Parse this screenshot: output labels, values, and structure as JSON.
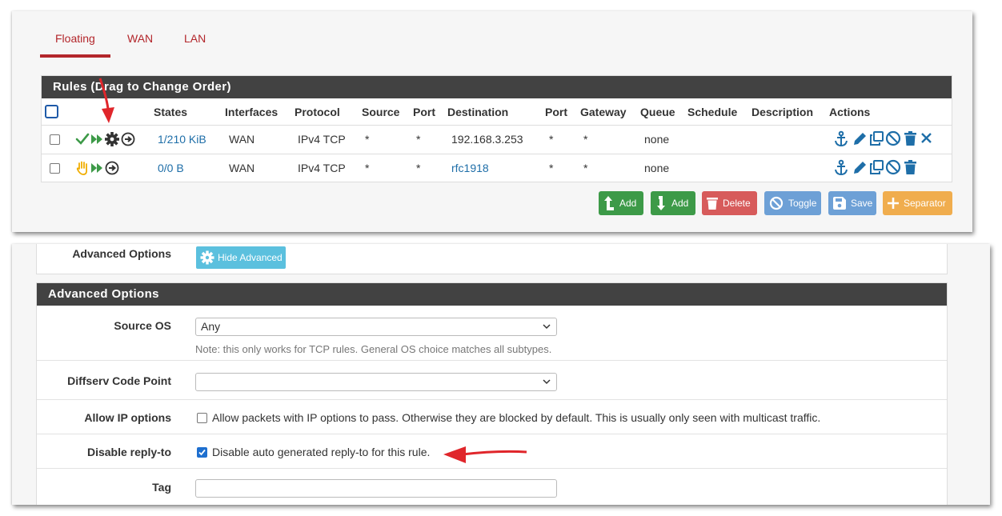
{
  "tabs": [
    {
      "label": "Floating",
      "active": true
    },
    {
      "label": "WAN",
      "active": false
    },
    {
      "label": "LAN",
      "active": false
    }
  ],
  "rules": {
    "title": "Rules (Drag to Change Order)",
    "columns": [
      "States",
      "Interfaces",
      "Protocol",
      "Source",
      "Port",
      "Destination",
      "Port",
      "Gateway",
      "Queue",
      "Schedule",
      "Description",
      "Actions"
    ],
    "rows": [
      {
        "states": "1/210 KiB",
        "interfaces": "WAN",
        "protocol": "IPv4 TCP",
        "source": "*",
        "source_port": "*",
        "destination": "192.168.3.253",
        "dest_port": "*",
        "gateway": "*",
        "queue": "none",
        "schedule": "",
        "description": "",
        "icons": [
          "check-icon",
          "forward-icon",
          "gear-icon",
          "arrow-circle-icon"
        ],
        "actions": [
          "anchor-icon",
          "pencil-icon",
          "copy-icon",
          "disable-icon",
          "trash-icon",
          "close-icon"
        ]
      },
      {
        "states": "0/0 B",
        "interfaces": "WAN",
        "protocol": "IPv4 TCP",
        "source": "*",
        "source_port": "*",
        "destination": "rfc1918",
        "dest_port": "*",
        "gateway": "*",
        "queue": "none",
        "schedule": "",
        "description": "",
        "icons": [
          "hand-icon",
          "forward-icon",
          "arrow-circle-icon"
        ],
        "actions": [
          "anchor-icon",
          "pencil-icon",
          "copy-icon",
          "disable-icon",
          "trash-icon"
        ]
      }
    ]
  },
  "buttons": {
    "add_top": "Add",
    "add_bottom": "Add",
    "delete": "Delete",
    "toggle": "Toggle",
    "save": "Save",
    "separator": "Separator"
  },
  "advanced_toggle": {
    "label": "Advanced Options",
    "button": "Hide Advanced"
  },
  "advanced": {
    "title": "Advanced Options",
    "source_os": {
      "label": "Source OS",
      "value": "Any",
      "note": "Note: this only works for TCP rules. General OS choice matches all subtypes."
    },
    "diffserv": {
      "label": "Diffserv Code Point",
      "value": ""
    },
    "allow_ip": {
      "label": "Allow IP options",
      "checked": false,
      "text": "Allow packets with IP options to pass. Otherwise they are blocked by default. This is usually only seen with multicast traffic."
    },
    "disable_reply": {
      "label": "Disable reply-to",
      "checked": true,
      "text": "Disable auto generated reply-to for this rule."
    },
    "tag": {
      "label": "Tag",
      "value": ""
    }
  },
  "colors": {
    "accent": "#b3262b",
    "header_bg": "#424242",
    "green": "#3d9a48",
    "red": "#d75b5b",
    "blue": "#6da0d6",
    "orange": "#f0ad4e",
    "info": "#5bc0de",
    "link": "#1e6ea8"
  }
}
